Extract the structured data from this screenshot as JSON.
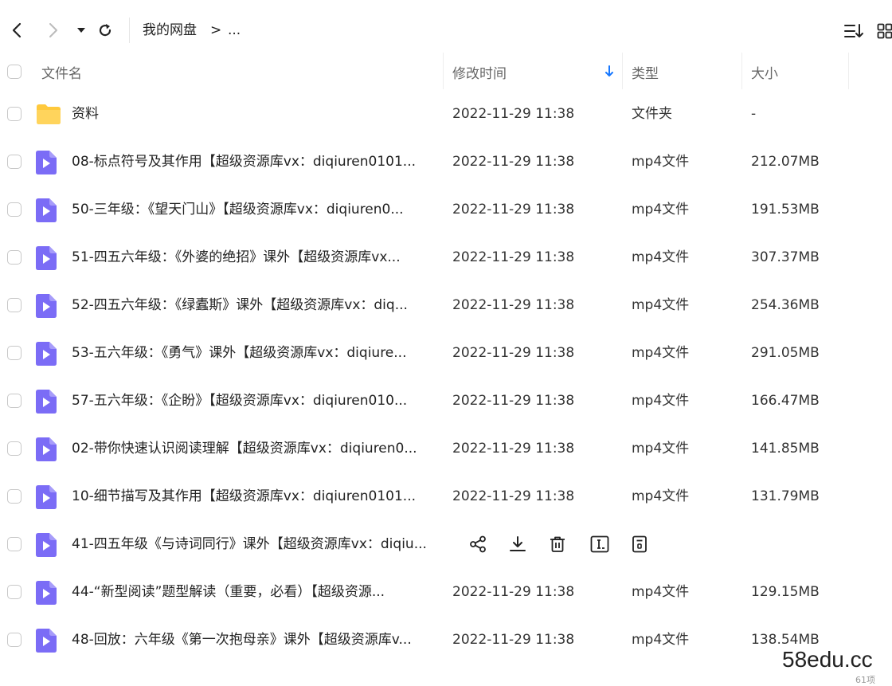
{
  "toolbar": {
    "breadcrumb_root": "我的网盘",
    "breadcrumb_sep": ">",
    "breadcrumb_more": "..."
  },
  "columns": {
    "name": "文件名",
    "modified": "修改时间",
    "type": "类型",
    "size": "大小"
  },
  "files": [
    {
      "name": "资料",
      "date": "2022-11-29 11:38",
      "type": "文件夹",
      "size": "-",
      "icon": "folder-icon"
    },
    {
      "name": "08-标点符号及其作用【超级资源库vx：diqiuren0101...",
      "date": "2022-11-29 11:38",
      "type": "mp4文件",
      "size": "212.07MB",
      "icon": "video-file-icon"
    },
    {
      "name": "50-三年级：《望天门山》【超级资源库vx：diqiuren0...",
      "date": "2022-11-29 11:38",
      "type": "mp4文件",
      "size": "191.53MB",
      "icon": "video-file-icon"
    },
    {
      "name": "51-四五六年级：《外婆的绝招》课外【超级资源库vx...",
      "date": "2022-11-29 11:38",
      "type": "mp4文件",
      "size": "307.37MB",
      "icon": "video-file-icon"
    },
    {
      "name": "52-四五六年级：《绿蠹斯》课外【超级资源库vx：diq...",
      "date": "2022-11-29 11:38",
      "type": "mp4文件",
      "size": "254.36MB",
      "icon": "video-file-icon"
    },
    {
      "name": "53-五六年级：《勇气》课外【超级资源库vx：diqiure...",
      "date": "2022-11-29 11:38",
      "type": "mp4文件",
      "size": "291.05MB",
      "icon": "video-file-icon"
    },
    {
      "name": "57-五六年级：《企盼》【超级资源库vx：diqiuren010...",
      "date": "2022-11-29 11:38",
      "type": "mp4文件",
      "size": "166.47MB",
      "icon": "video-file-icon"
    },
    {
      "name": "02-带你快速认识阅读理解【超级资源库vx：diqiuren0...",
      "date": "2022-11-29 11:38",
      "type": "mp4文件",
      "size": "141.85MB",
      "icon": "video-file-icon"
    },
    {
      "name": "10-细节描写及其作用【超级资源库vx：diqiuren0101...",
      "date": "2022-11-29 11:38",
      "type": "mp4文件",
      "size": "131.79MB",
      "icon": "video-file-icon"
    },
    {
      "name": "41-四五年级《与诗词同行》课外【超级资源库vx：diqiu...",
      "date": "",
      "type": "",
      "size": "",
      "icon": "video-file-icon",
      "hovered": true
    },
    {
      "name": "44-“新型阅读”题型解读（重要，必看）【超级资源...",
      "date": "2022-11-29 11:38",
      "type": "mp4文件",
      "size": "129.15MB",
      "icon": "video-file-icon"
    },
    {
      "name": "48-回放：六年级《第一次抱母亲》课外【超级资源库v...",
      "date": "2022-11-29 11:38",
      "type": "mp4文件",
      "size": "138.54MB",
      "icon": "video-file-icon"
    }
  ],
  "row_actions": [
    "share-icon",
    "download-icon",
    "delete-icon",
    "rename-icon",
    "more-icon"
  ],
  "watermark": "58edu.cc",
  "corner_text": "61项",
  "colors": {
    "folder": "#FFC93C",
    "video_file": "#7B6CF6",
    "sort_arrow": "#1677FF"
  }
}
